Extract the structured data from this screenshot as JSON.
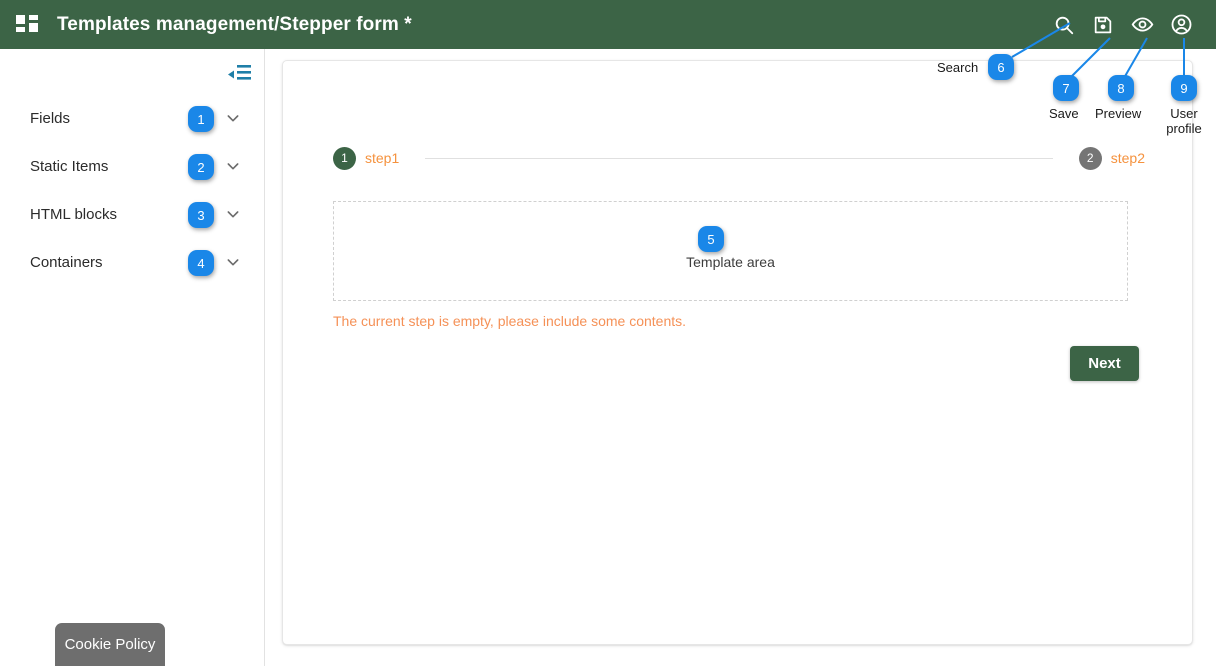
{
  "header": {
    "app_icon": "dashboard-grid-icon",
    "title": "Templates management/Stepper form *",
    "bg_color": "#3c6446",
    "actions": [
      {
        "name": "search-icon",
        "label": "Search"
      },
      {
        "name": "save-icon",
        "label": "Save"
      },
      {
        "name": "preview-icon",
        "label": "Preview"
      },
      {
        "name": "user-profile-icon",
        "label": "User profile"
      }
    ]
  },
  "sidebar": {
    "collapse_icon": "collapse-menu-icon",
    "items": [
      {
        "label": "Fields",
        "badge": "1",
        "chevron": "chevron-down-icon"
      },
      {
        "label": "Static Items",
        "badge": "2",
        "chevron": "chevron-down-icon"
      },
      {
        "label": "HTML blocks",
        "badge": "3",
        "chevron": "chevron-down-icon"
      },
      {
        "label": "Containers",
        "badge": "4",
        "chevron": "chevron-down-icon"
      }
    ]
  },
  "main": {
    "stepper": {
      "steps": [
        {
          "number": "1",
          "label": "step1",
          "state": "active",
          "circle_color": "#3c6446"
        },
        {
          "number": "2",
          "label": "step2",
          "state": "inactive",
          "circle_color": "#757575"
        }
      ],
      "label_color": "#f5923e"
    },
    "template_area": {
      "label": "Template area",
      "badge": "5"
    },
    "error_message": "The current step is empty, please include some contents.",
    "error_color": "#f59157",
    "next_button": "Next"
  },
  "cookie_policy": {
    "label": "Cookie Policy",
    "bg_color": "#6e6e6e"
  },
  "annotations": {
    "badge_color": "#1a87e8",
    "items": [
      {
        "badge": "1",
        "label": ""
      },
      {
        "badge": "2",
        "label": ""
      },
      {
        "badge": "3",
        "label": ""
      },
      {
        "badge": "4",
        "label": ""
      },
      {
        "badge": "5",
        "label": ""
      },
      {
        "badge": "6",
        "label": "Search"
      },
      {
        "badge": "7",
        "label": "Save"
      },
      {
        "badge": "8",
        "label": "Preview"
      },
      {
        "badge": "9",
        "label": "User profile"
      }
    ]
  }
}
